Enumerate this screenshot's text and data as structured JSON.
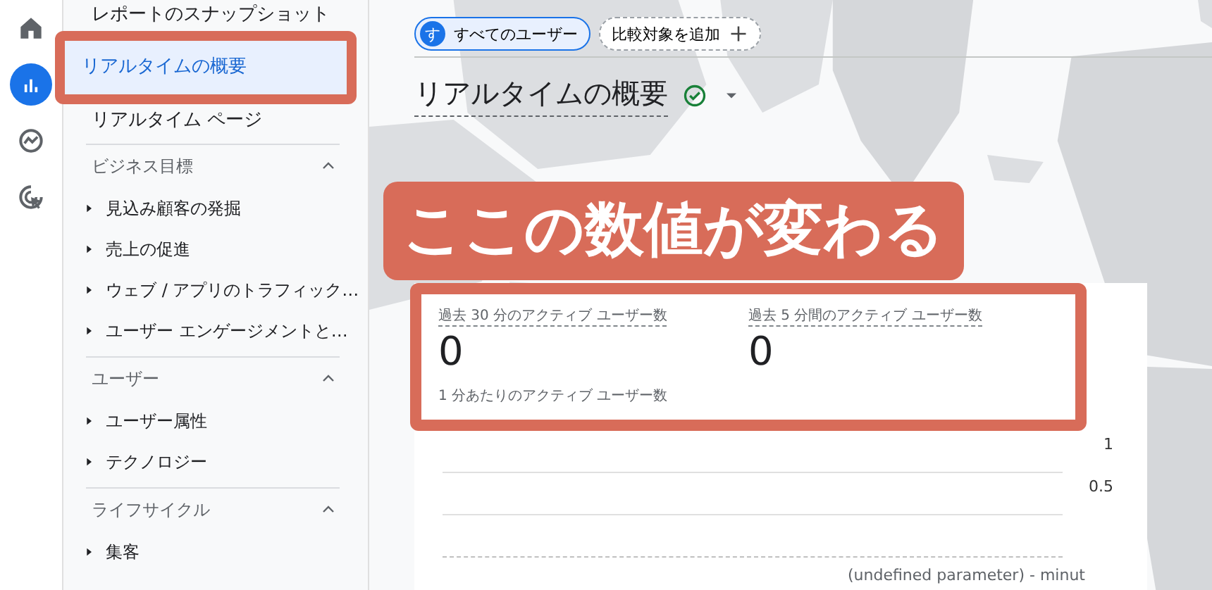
{
  "rail": {
    "items": [
      {
        "kind": "home",
        "selected": false
      },
      {
        "kind": "reports",
        "selected": true
      },
      {
        "kind": "explore",
        "selected": false
      },
      {
        "kind": "advertising",
        "selected": false
      }
    ]
  },
  "sidebar": {
    "entries": [
      {
        "kind": "link",
        "label": "レポートのスナップショット",
        "selected": false,
        "highlighted": false
      },
      {
        "kind": "link",
        "label": "リアルタイムの概要",
        "selected": true,
        "highlighted": true
      },
      {
        "kind": "link",
        "label": "リアルタイム ページ",
        "selected": false,
        "highlighted": false
      },
      {
        "kind": "section",
        "label": "ビジネス目標",
        "expanded": true,
        "children": [
          {
            "label": "見込み顧客の発掘",
            "expanded": false
          },
          {
            "label": "売上の促進",
            "expanded": false
          },
          {
            "label": "ウェブ / アプリのトラフィック…",
            "expanded": false
          },
          {
            "label": "ユーザー エンゲージメントと…",
            "expanded": false
          }
        ]
      },
      {
        "kind": "section",
        "label": "ユーザー",
        "expanded": true,
        "children": [
          {
            "label": "ユーザー属性",
            "expanded": false
          },
          {
            "label": "テクノロジー",
            "expanded": false
          }
        ]
      },
      {
        "kind": "section",
        "label": "ライフサイクル",
        "expanded": true,
        "children": [
          {
            "label": "集客",
            "expanded": false
          }
        ]
      }
    ]
  },
  "filters": {
    "segment": {
      "avatar": "す",
      "label": "すべてのユーザー"
    },
    "add_comparison": "比較対象を追加"
  },
  "page_title": "リアルタイムの概要",
  "callout": "ここの数値が変わる",
  "card": {
    "highlighted": true,
    "metrics": [
      {
        "label": "過去 30 分のアクティブ ユーザー数",
        "value": "0"
      },
      {
        "label": "過去 5 分間のアクティブ ユーザー数",
        "value": "0"
      }
    ],
    "subtitle": "1 分あたりのアクティブ ユーザー数",
    "y_ticks": [
      "1",
      "0.5"
    ],
    "x_axis_label": "(undefined parameter) - minut"
  }
}
